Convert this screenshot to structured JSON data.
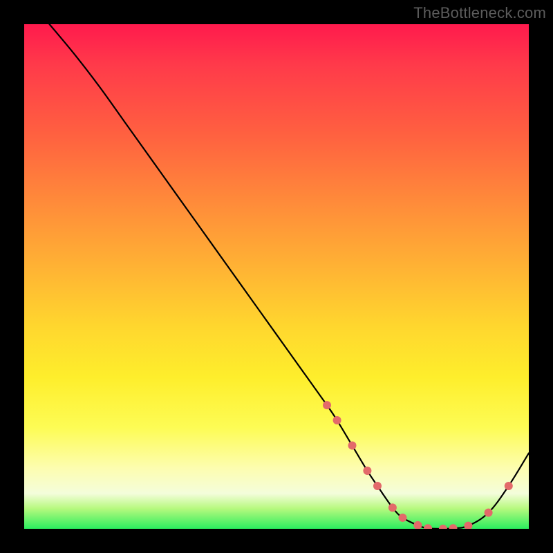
{
  "watermark": "TheBottleneck.com",
  "chart_data": {
    "type": "line",
    "title": "",
    "xlabel": "",
    "ylabel": "",
    "xlim": [
      0,
      100
    ],
    "ylim": [
      0,
      100
    ],
    "grid": false,
    "series": [
      {
        "name": "bottleneck-curve",
        "color": "#000000",
        "x": [
          5,
          10,
          15,
          20,
          25,
          30,
          35,
          40,
          45,
          50,
          55,
          60,
          62,
          65,
          68,
          70,
          73,
          75,
          78,
          80,
          83,
          85,
          88,
          92,
          96,
          100
        ],
        "y": [
          100,
          94,
          87.5,
          80.5,
          73.5,
          66.5,
          59.5,
          52.5,
          45.5,
          38.5,
          31.5,
          24.5,
          21.5,
          16.5,
          11.5,
          8.5,
          4.2,
          2.2,
          0.7,
          0.1,
          0,
          0.1,
          0.6,
          3.2,
          8.5,
          15
        ]
      }
    ],
    "markers": {
      "name": "highlight-dots",
      "series_index": 0,
      "point_indices": [
        11,
        12,
        13,
        14,
        15,
        16,
        17,
        18,
        19,
        20,
        21,
        22,
        23,
        24
      ],
      "color": "#e36a6a",
      "size": 6
    },
    "gradient_background": {
      "direction": "vertical",
      "stops": [
        {
          "pos": 0.0,
          "color": "#ff1a4d"
        },
        {
          "pos": 0.35,
          "color": "#ff8a3a"
        },
        {
          "pos": 0.6,
          "color": "#ffd72e"
        },
        {
          "pos": 0.88,
          "color": "#fdfdb0"
        },
        {
          "pos": 1.0,
          "color": "#2bee5e"
        }
      ]
    }
  }
}
